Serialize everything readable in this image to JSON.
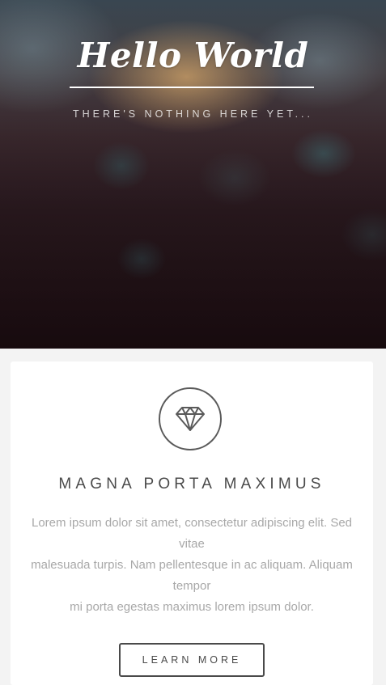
{
  "hero": {
    "title": "Hello World",
    "tagline": "THERE'S NOTHING HERE YET..."
  },
  "feature": {
    "icon": "diamond-icon",
    "title": "MAGNA PORTA MAXIMUS",
    "lines": [
      "Lorem ipsum dolor sit amet, consectetur adipiscing elit. Sed",
      "vitae",
      "malesuada turpis. Nam pellentesque in ac aliquam. Aliquam",
      "tempor",
      "mi porta egestas maximus lorem ipsum dolor."
    ],
    "button_label": "LEARN MORE"
  },
  "colors": {
    "page_background": "#f3f3f3",
    "card_background": "#ffffff",
    "text_dark": "#4a4a4a",
    "text_muted": "#a8a8a8"
  }
}
